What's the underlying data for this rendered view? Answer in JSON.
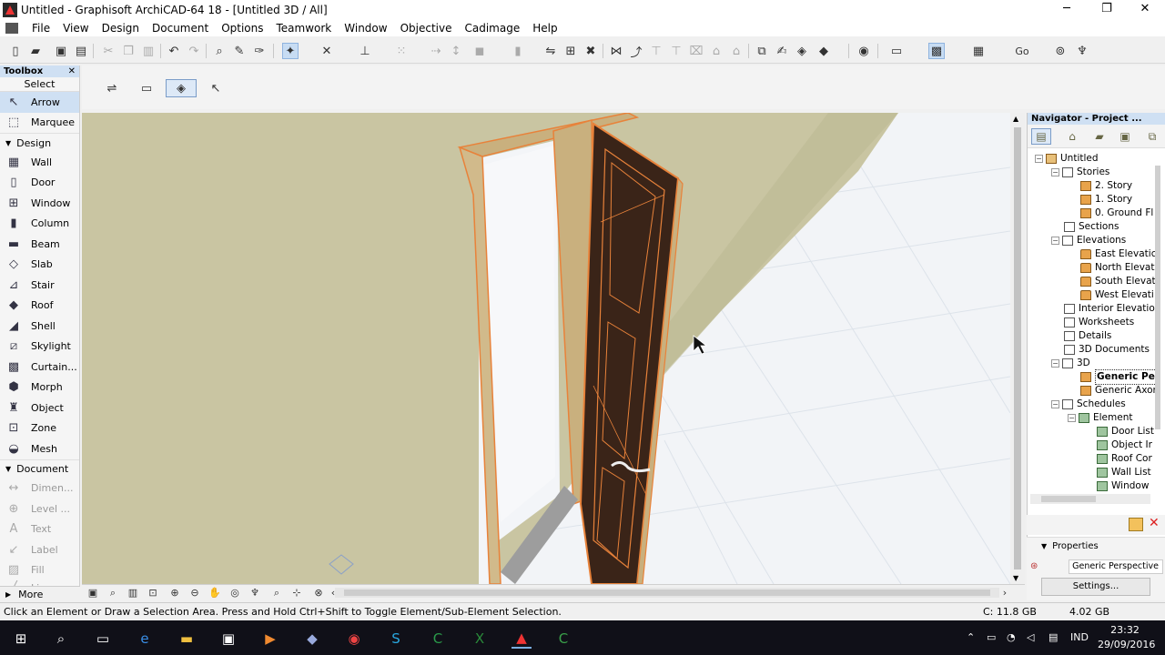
{
  "window": {
    "title": "Untitled - Graphisoft ArchiCAD-64 18 - [Untitled 3D / All]",
    "minimize": "─",
    "restore": "❐",
    "close": "✕"
  },
  "menu": [
    "File",
    "View",
    "Design",
    "Document",
    "Options",
    "Teamwork",
    "Window",
    "Objective",
    "Cadimage",
    "Help"
  ],
  "toolbar_icons": [
    "new-icon",
    "open-icon",
    "save-icon",
    "print-icon",
    "cut-icon",
    "copy-icon",
    "paste-icon",
    "undo-icon",
    "redo-icon",
    "find-icon",
    "pick-icon",
    "inject-icon",
    "magic-wand-icon",
    "trim-icon",
    "align-icon",
    "grid-icon",
    "move-icon",
    "elevate-icon",
    "rotate-icon",
    "group-icon",
    "lock-icon",
    "layer-icon",
    "table-icon",
    "delete-icon"
  ],
  "toolbox": {
    "header": "Toolbox",
    "close": "✕",
    "select_label": "Select",
    "arrow": "Arrow",
    "marquee": "Marquee",
    "design_group": "Design",
    "design_tools": [
      "Wall",
      "Door",
      "Window",
      "Column",
      "Beam",
      "Slab",
      "Stair",
      "Roof",
      "Shell",
      "Skylight",
      "Curtain...",
      "Morph",
      "Object",
      "Zone",
      "Mesh"
    ],
    "document_group": "Document",
    "document_tools": [
      "Dimen...",
      "Level ...",
      "Text",
      "Label",
      "Fill",
      "Line"
    ],
    "more": "More"
  },
  "navigator": {
    "header": "Navigator - Project ...",
    "tree": {
      "root": "Untitled",
      "stories": "Stories",
      "story_items": [
        "2. Story",
        "1. Story",
        "0. Ground Fl"
      ],
      "sections": "Sections",
      "elevations": "Elevations",
      "elevation_items": [
        "East Elevatic",
        "North Elevat",
        "South Elevat",
        "West Elevati"
      ],
      "interior": "Interior Elevation",
      "worksheets": "Worksheets",
      "details": "Details",
      "documents3d": "3D Documents",
      "threed": "3D",
      "threed_items": [
        "Generic Pe",
        "Generic Axor"
      ],
      "schedules": "Schedules",
      "element": "Element",
      "element_items": [
        "Door List",
        "Object Ir",
        "Roof Cor",
        "Wall List",
        "Window"
      ]
    },
    "properties_label": "Properties",
    "properties_value": "Generic Perspective",
    "settings": "Settings..."
  },
  "status": {
    "message": "Click an Element or Draw a Selection Area. Press and Hold Ctrl+Shift to Toggle Element/Sub-Element Selection.",
    "capacity": "C: 11.8 GB",
    "memory": "4.02 GB"
  },
  "taskbar": {
    "language": "IND",
    "time": "23:32",
    "date": "29/09/2016"
  },
  "colors": {
    "selection_orange": "#e8823a",
    "door_leaf": "#3a2418",
    "wall": "#c8c4a0",
    "floor": "#f0f2f6"
  }
}
